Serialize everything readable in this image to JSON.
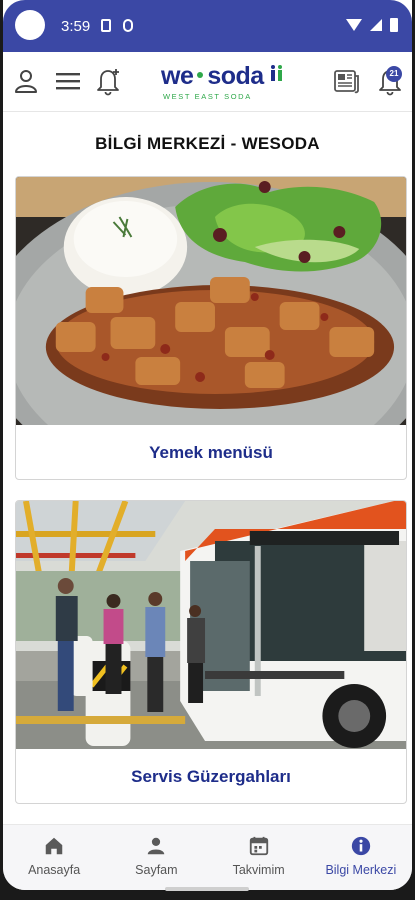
{
  "status_bar": {
    "time": "3:59"
  },
  "header": {
    "logo_text_left": "we",
    "logo_text_right": "soda",
    "logo_subtitle": "WEST EAST SODA",
    "notification_count": "21"
  },
  "page": {
    "title": "BİLGİ MERKEZİ - WESODA"
  },
  "cards": [
    {
      "label": "Yemek menüsü"
    },
    {
      "label": "Servis Güzergahları"
    }
  ],
  "bottom_nav": {
    "items": [
      {
        "label": "Anasayfa",
        "icon": "home-icon"
      },
      {
        "label": "Sayfam",
        "icon": "person-icon"
      },
      {
        "label": "Takvimim",
        "icon": "calendar-icon"
      },
      {
        "label": "Bilgi Merkezi",
        "icon": "info-icon"
      }
    ],
    "active_index": 3
  },
  "colors": {
    "primary": "#3b48a5",
    "brand_blue": "#1e2d8a",
    "brand_green": "#2fa84a"
  }
}
